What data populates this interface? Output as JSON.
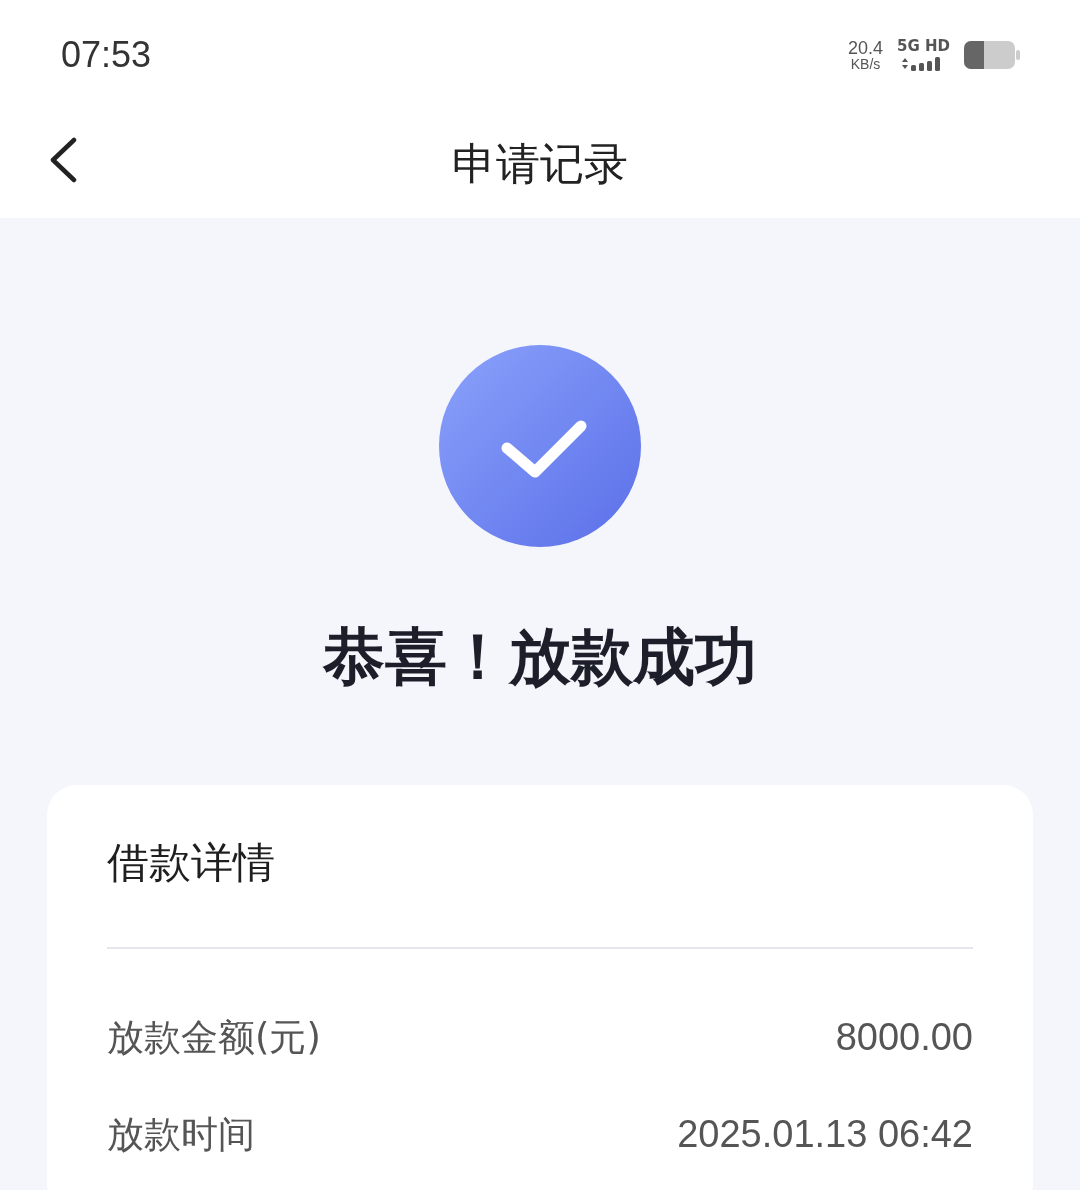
{
  "status_bar": {
    "time": "07:53",
    "speed": "20.4",
    "speed_unit": "KB/s",
    "network": "5G HD"
  },
  "header": {
    "back": true,
    "title": "申请记录"
  },
  "result": {
    "success": true,
    "message": "恭喜！放款成功"
  },
  "card": {
    "title": "借款详情",
    "rows": [
      {
        "label": "放款金额(元)",
        "value": "8000.00"
      },
      {
        "label": "放款时间",
        "value": "2025.01.13 06:42"
      }
    ]
  }
}
